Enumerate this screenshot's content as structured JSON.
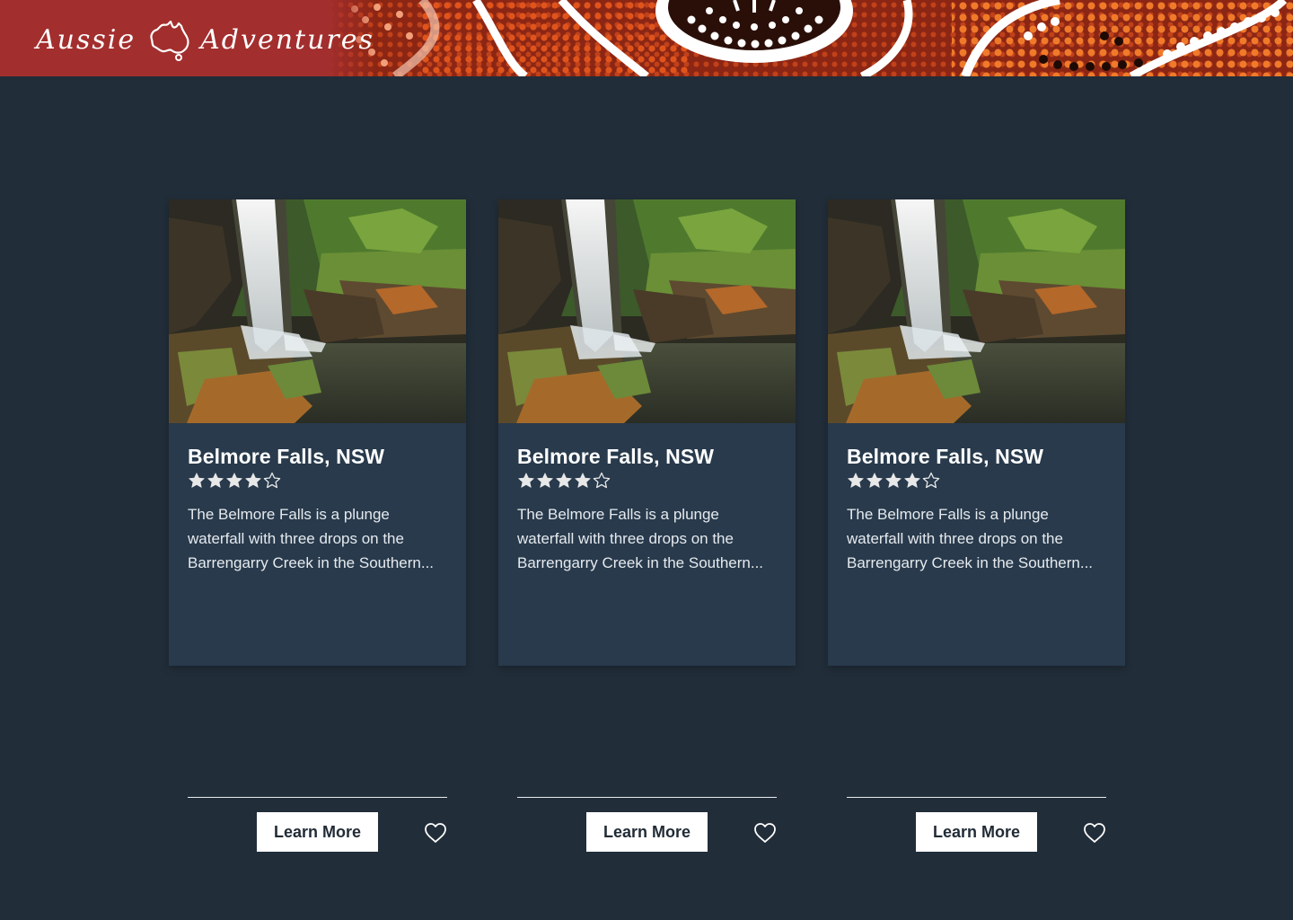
{
  "header": {
    "logo_left": "Aussie",
    "logo_right": "Adventures",
    "logo_icon": "australia-map-icon",
    "brand_color": "#a32e2e"
  },
  "colors": {
    "page_background": "#212d39",
    "card_background": "#283a4c",
    "button_background": "#ffffff",
    "button_text": "#222c36"
  },
  "cards": [
    {
      "title": "Belmore Falls, NSW",
      "rating": 4,
      "rating_max": 5,
      "description": "The Belmore Falls is a plunge waterfall with three drops on the Barrengarry Creek in the Southern...",
      "button_label": "Learn More",
      "favorite_icon": "heart-outline-icon",
      "image": "waterfall-photo"
    },
    {
      "title": "Belmore Falls, NSW",
      "rating": 4,
      "rating_max": 5,
      "description": "The Belmore Falls is a plunge waterfall with three drops on the Barrengarry Creek in the Southern...",
      "button_label": "Learn More",
      "favorite_icon": "heart-outline-icon",
      "image": "waterfall-photo"
    },
    {
      "title": "Belmore Falls, NSW",
      "rating": 4,
      "rating_max": 5,
      "description": "The Belmore Falls is a plunge waterfall with three drops on the Barrengarry Creek in the Southern...",
      "button_label": "Learn More",
      "favorite_icon": "heart-outline-icon",
      "image": "waterfall-photo"
    }
  ]
}
